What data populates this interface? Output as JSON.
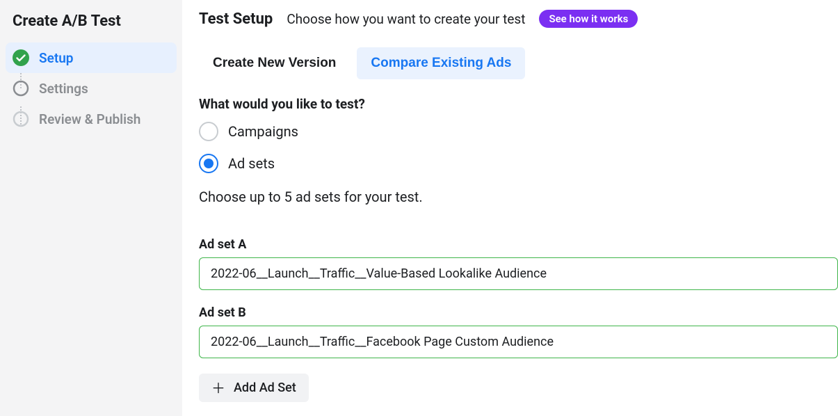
{
  "sidebar": {
    "title": "Create A/B Test",
    "steps": [
      {
        "label": "Setup",
        "state": "active"
      },
      {
        "label": "Settings",
        "state": "pending"
      },
      {
        "label": "Review & Publish",
        "state": "pending"
      }
    ]
  },
  "header": {
    "title": "Test Setup",
    "subtitle": "Choose how you want to create your test",
    "help_pill": "See how it works"
  },
  "tabs": [
    {
      "label": "Create New Version",
      "active": false
    },
    {
      "label": "Compare Existing Ads",
      "active": true
    }
  ],
  "question": "What would you like to test?",
  "radio_options": [
    {
      "label": "Campaigns",
      "selected": false
    },
    {
      "label": "Ad sets",
      "selected": true
    }
  ],
  "helper_text": "Choose up to 5 ad sets for your test.",
  "adsets": [
    {
      "label": "Ad set A",
      "value": "2022-06__Launch__Traffic__Value-Based Lookalike Audience"
    },
    {
      "label": "Ad set B",
      "value": "2022-06__Launch__Traffic__Facebook Page Custom Audience"
    }
  ],
  "add_button": "Add Ad Set"
}
